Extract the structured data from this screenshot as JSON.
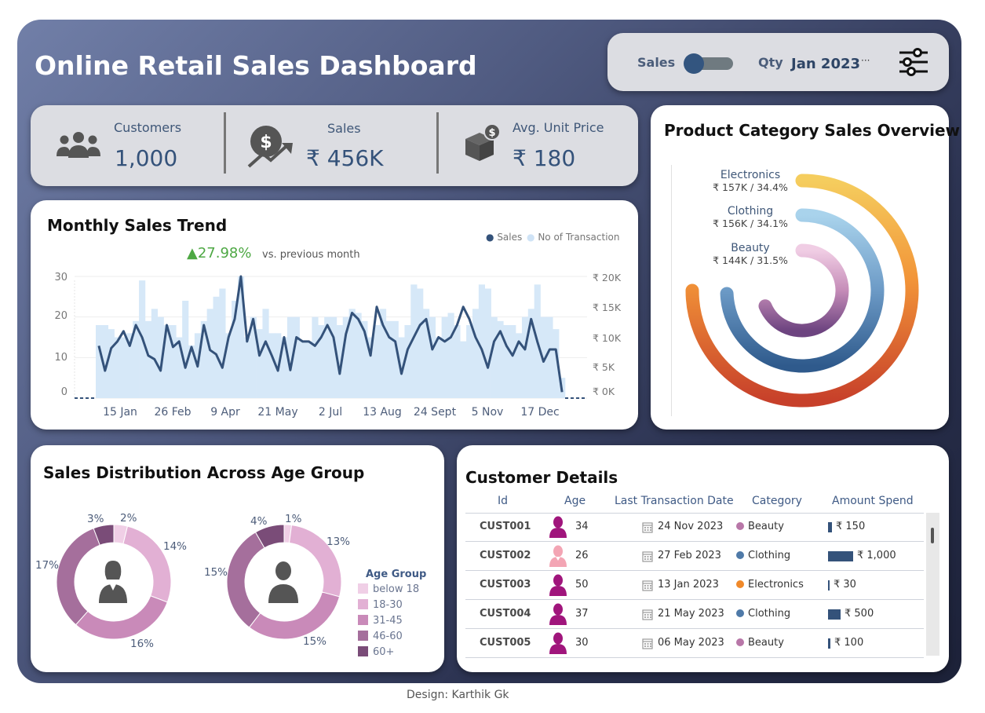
{
  "title": "Online Retail Sales Dashboard",
  "controls": {
    "toggle_left": "Sales",
    "toggle_right": "Qty",
    "date": "Jan 2023",
    "more": "···",
    "filter_icon": "sliders-icon"
  },
  "kpis": [
    {
      "label": "Customers",
      "value": "1,000",
      "icon": "people-icon"
    },
    {
      "label": "Sales",
      "value": "₹ 456K",
      "icon": "sales-growth-icon"
    },
    {
      "label": "Avg. Unit Price",
      "value": "₹ 180",
      "icon": "box-price-icon"
    }
  ],
  "trend": {
    "title": "Monthly Sales Trend",
    "legend_sales": "Sales",
    "legend_txn": "No of Transaction",
    "change": "▲27.98%",
    "change_note": "vs. previous month",
    "colors": {
      "sales": "#34527a",
      "txn": "#d6e8f8",
      "change": "#4ea844"
    }
  },
  "chart_data": {
    "type": "bar",
    "x_ticks": [
      "15 Jan",
      "26 Feb",
      "9 Apr",
      "21 May",
      "2 Jul",
      "13 Aug",
      "24 Sept",
      "5 Nov",
      "17 Dec"
    ],
    "y_left_ticks": [
      "30",
      "20",
      "10",
      "0"
    ],
    "y_right_ticks": [
      "₹ 20K",
      "₹ 15K",
      "₹ 10K",
      "₹ 5K",
      "₹ 0K"
    ],
    "ylim_left": [
      0,
      30
    ],
    "ylim_right": [
      0,
      20000
    ],
    "series": [
      {
        "name": "No of Transaction",
        "type": "bar",
        "values": [
          18,
          18,
          17,
          15,
          15,
          16,
          19,
          29,
          19,
          22,
          20,
          18,
          18,
          15,
          24,
          13,
          16,
          19,
          22,
          25,
          27,
          16,
          24,
          30,
          15,
          20,
          17,
          22,
          16,
          16,
          15,
          20,
          20,
          14,
          14,
          20,
          18,
          20,
          20,
          18,
          20,
          22,
          21,
          19,
          15,
          18,
          22,
          19,
          19,
          15,
          18,
          28,
          27,
          22,
          20,
          15,
          20,
          21,
          18,
          14,
          18,
          22,
          28,
          27,
          20,
          19,
          18,
          18,
          16,
          20,
          22,
          28,
          20,
          20,
          17,
          5
        ]
      },
      {
        "name": "Sales",
        "type": "line",
        "values": [
          8600,
          4500,
          8200,
          9300,
          11000,
          8600,
          12000,
          10000,
          7000,
          6400,
          4500,
          12000,
          8400,
          9300,
          5000,
          8400,
          5200,
          12000,
          7900,
          7200,
          5000,
          10000,
          13000,
          20000,
          9300,
          13000,
          7000,
          9300,
          7000,
          4500,
          10000,
          4600,
          10000,
          9300,
          9300,
          8600,
          10000,
          12000,
          10000,
          4000,
          10500,
          14000,
          13000,
          11000,
          7000,
          15000,
          12000,
          10000,
          9300,
          4000,
          8000,
          10000,
          12000,
          13000,
          8000,
          10000,
          9300,
          10000,
          12000,
          15000,
          13000,
          10000,
          8000,
          5000,
          9300,
          11000,
          8600,
          7000,
          9300,
          8000,
          13000,
          9300,
          6000,
          8000,
          8000,
          1000
        ]
      }
    ]
  },
  "category": {
    "title": "Product Category Sales Overview",
    "items": [
      {
        "name": "Electronics",
        "value": "₹ 157K / 34.4%",
        "share": 34.4
      },
      {
        "name": "Clothing",
        "value": "₹ 156K / 34.1%",
        "share": 34.1
      },
      {
        "name": "Beauty",
        "value": "₹ 144K / 31.5%",
        "share": 31.5
      }
    ]
  },
  "age": {
    "title": "Sales Distribution Across Age Group",
    "female": {
      "icon": "female-user-icon",
      "pcts": [
        "2%",
        "14%",
        "16%",
        "17%",
        "3%"
      ],
      "values": [
        2,
        14,
        16,
        17,
        3
      ]
    },
    "male": {
      "icon": "male-user-icon",
      "pcts": [
        "1%",
        "13%",
        "15%",
        "15%",
        "4%"
      ],
      "values": [
        1,
        13,
        15,
        15,
        4
      ]
    },
    "legend_title": "Age Group",
    "groups": [
      "below 18",
      "18-30",
      "31-45",
      "46-60",
      "60+"
    ],
    "colors": [
      "#f0cfe6",
      "#e2b0d4",
      "#c98ab9",
      "#a56f9c",
      "#7a4c78"
    ]
  },
  "customers": {
    "title": "Customer Details",
    "headers": [
      "Id",
      "Age",
      "Last Transaction Date",
      "Category",
      "Amount Spend"
    ],
    "rows": [
      {
        "id": "CUST001",
        "gender": "male",
        "age": "34",
        "date": "24 Nov 2023",
        "category": "Beauty",
        "cat_color": "#b877a8",
        "amount": "₹ 150",
        "amount_value": 150
      },
      {
        "id": "CUST002",
        "gender": "female",
        "age": "26",
        "date": "27 Feb 2023",
        "category": "Clothing",
        "cat_color": "#4f7aa8",
        "amount": "₹ 1,000",
        "amount_value": 1000
      },
      {
        "id": "CUST003",
        "gender": "male",
        "age": "50",
        "date": "13 Jan 2023",
        "category": "Electronics",
        "cat_color": "#f0892a",
        "amount": "₹ 30",
        "amount_value": 30
      },
      {
        "id": "CUST004",
        "gender": "male",
        "age": "37",
        "date": "21 May 2023",
        "category": "Clothing",
        "cat_color": "#4f7aa8",
        "amount": "₹ 500",
        "amount_value": 500
      },
      {
        "id": "CUST005",
        "gender": "male",
        "age": "30",
        "date": "06 May 2023",
        "category": "Beauty",
        "cat_color": "#b877a8",
        "amount": "₹ 100",
        "amount_value": 100
      }
    ]
  },
  "credit": "Design: Karthik Gk"
}
